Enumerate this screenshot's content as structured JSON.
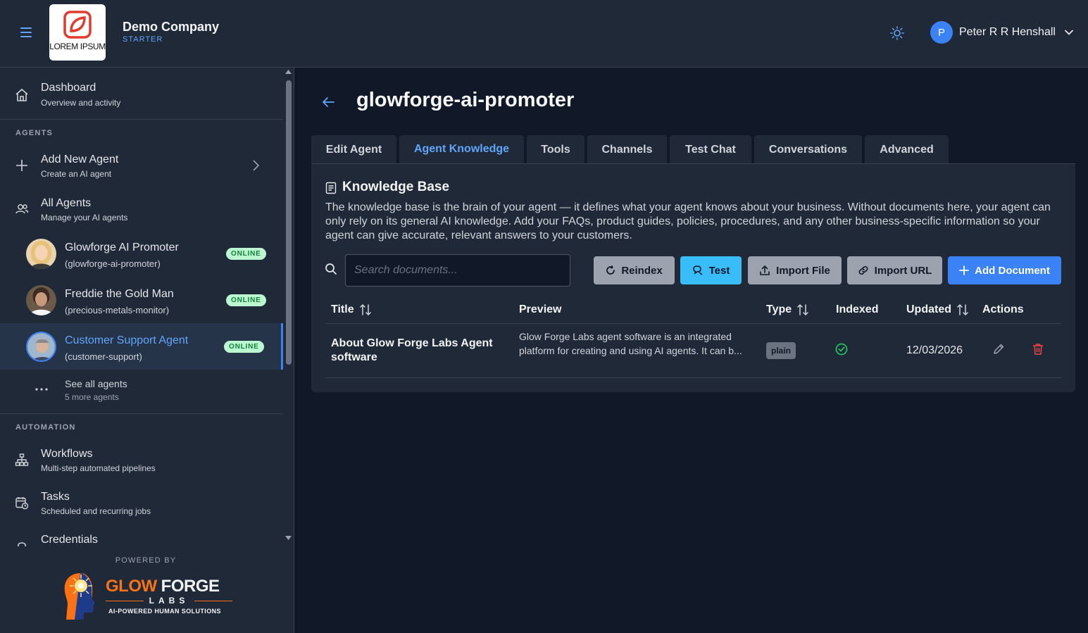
{
  "header": {
    "logo_text": "LOREM IPSUM",
    "company_name": "Demo Company",
    "plan": "STARTER",
    "user_initial": "P",
    "user_name": "Peter R R Henshall"
  },
  "sidebar": {
    "dashboard": {
      "title": "Dashboard",
      "subtitle": "Overview and activity"
    },
    "agents_label": "AGENTS",
    "add_agent": {
      "title": "Add New Agent",
      "subtitle": "Create an AI agent"
    },
    "all_agents": {
      "title": "All Agents",
      "subtitle": "Manage your AI agents"
    },
    "agents": [
      {
        "name": "Glowforge AI Promoter",
        "slug": "(glowforge-ai-promoter)",
        "status": "ONLINE"
      },
      {
        "name": "Freddie the Gold Man",
        "slug": "(precious-metals-monitor)",
        "status": "ONLINE"
      },
      {
        "name": "Customer Support Agent",
        "slug": "(customer-support)",
        "status": "ONLINE"
      }
    ],
    "see_all": {
      "title": "See all agents",
      "subtitle": "5 more agents"
    },
    "automation_label": "AUTOMATION",
    "workflows": {
      "title": "Workflows",
      "subtitle": "Multi-step automated pipelines"
    },
    "tasks": {
      "title": "Tasks",
      "subtitle": "Scheduled and recurring jobs"
    },
    "credentials": {
      "title": "Credentials"
    },
    "powered_by": "POWERED BY",
    "brand": {
      "line1a": "GLOW",
      "line1b": "FORGE",
      "line2": "LABS",
      "tagline": "AI-POWERED HUMAN SOLUTIONS"
    }
  },
  "main": {
    "title": "glowforge-ai-promoter",
    "tabs": [
      "Edit Agent",
      "Agent Knowledge",
      "Tools",
      "Channels",
      "Test Chat",
      "Conversations",
      "Advanced"
    ],
    "kb": {
      "title": "Knowledge Base",
      "description": "The knowledge base is the brain of your agent — it defines what your agent knows about your business. Without documents here, your agent can only rely on its general AI knowledge. Add your FAQs, product guides, policies, procedures, and any other business-specific information so your agent can give accurate, relevant answers to your customers.",
      "search_placeholder": "Search documents...",
      "buttons": {
        "reindex": "Reindex",
        "test": "Test",
        "import_file": "Import File",
        "import_url": "Import URL",
        "add_document": "Add Document"
      },
      "columns": [
        "Title",
        "Preview",
        "Type",
        "Indexed",
        "Updated",
        "Actions"
      ],
      "rows": [
        {
          "title": "About Glow Forge Labs Agent software",
          "preview": "Glow Forge Labs agent software is an integrated platform for creating and using AI agents. It can b...",
          "type": "plain",
          "updated": "12/03/2026"
        }
      ]
    }
  },
  "colors": {
    "accent": "#3b82f6",
    "online": "#bbf7d0",
    "danger": "#ef4444",
    "success": "#22c55e"
  }
}
